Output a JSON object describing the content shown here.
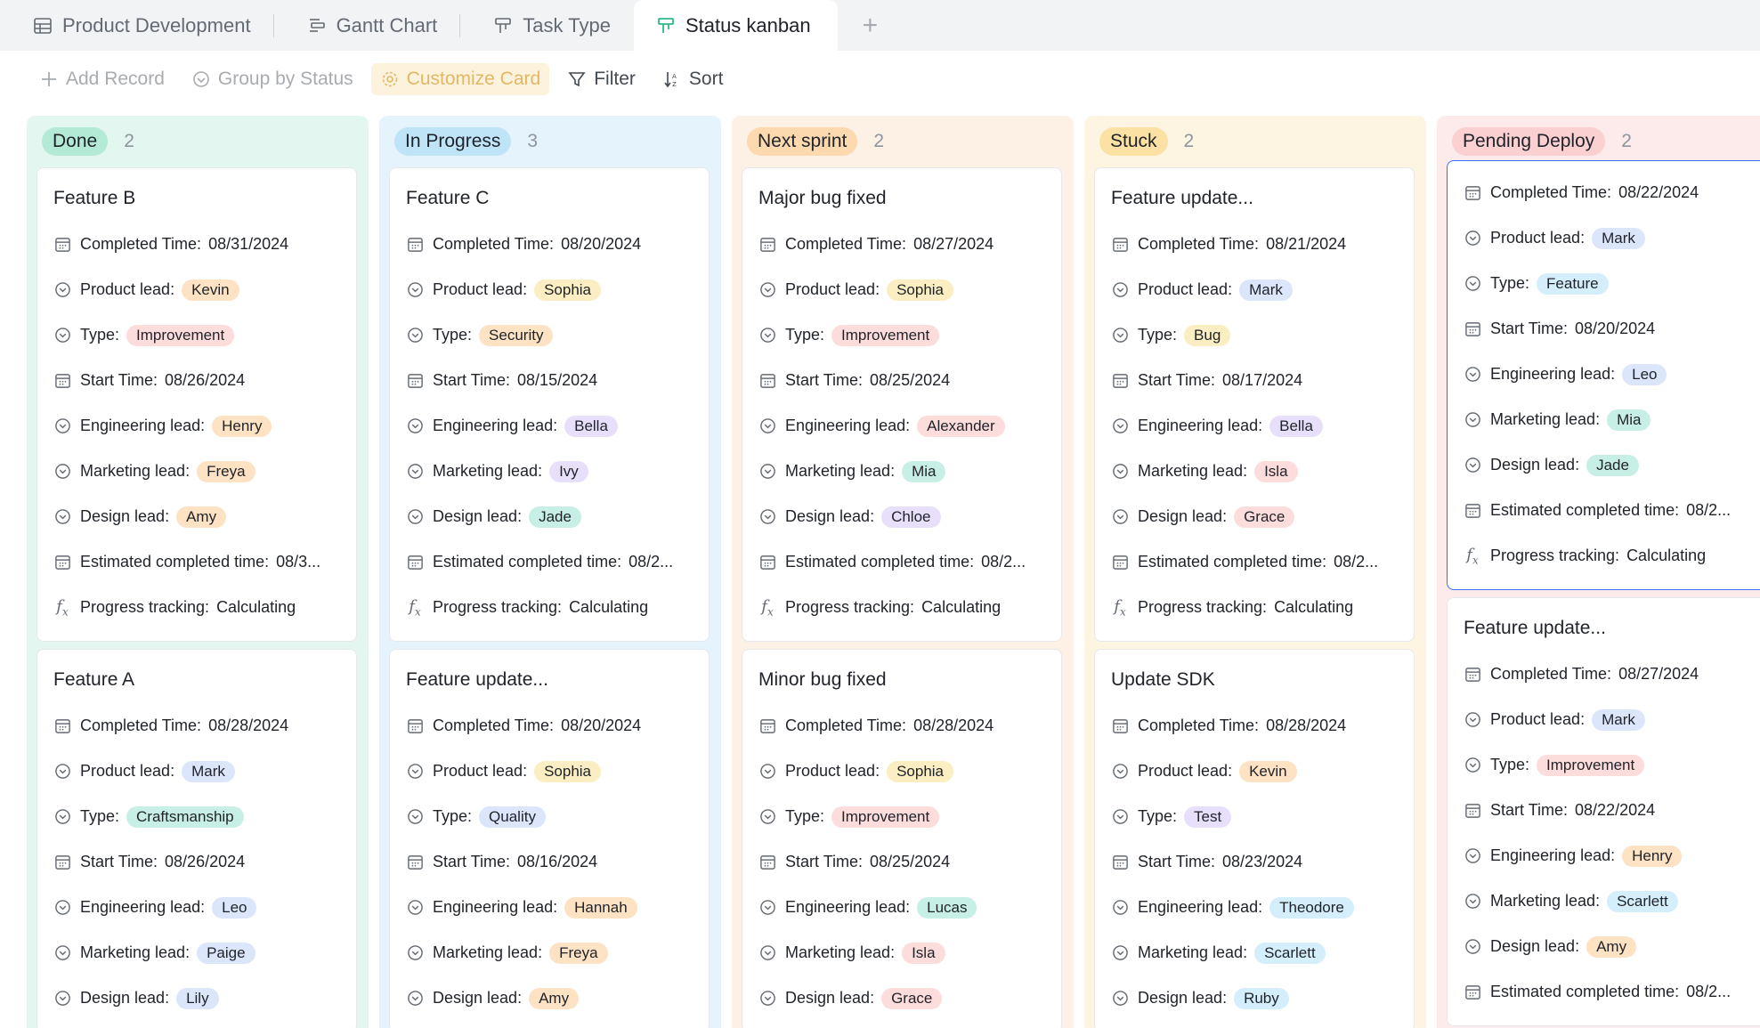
{
  "tabs": [
    {
      "label": "Product Development",
      "icon": "table-icon"
    },
    {
      "label": "Gantt Chart",
      "icon": "gantt-icon"
    },
    {
      "label": "Task Type",
      "icon": "kanban-icon"
    },
    {
      "label": "Status kanban",
      "icon": "kanban-icon",
      "active": true
    }
  ],
  "tab_add": "+",
  "toolbar": {
    "add_record": "Add Record",
    "group_by": "Group by Status",
    "customize": "Customize Card",
    "filter": "Filter",
    "sort": "Sort"
  },
  "colors": {
    "accent_blue": "#3370ff",
    "tag_orange": "#fde2c4",
    "tag_red": "#fddcdc",
    "tag_blue": "#dbe6fb",
    "tag_teal": "#c8efe5",
    "tag_purple": "#e8e0fb",
    "tag_yellow": "#fbeec2",
    "tag_cyan": "#d4eefb"
  },
  "field_labels": {
    "completed": "Completed Time:",
    "product": "Product lead:",
    "type": "Type:",
    "start": "Start Time:",
    "engineering": "Engineering lead:",
    "marketing": "Marketing lead:",
    "design": "Design lead:",
    "estimated": "Estimated completed time:",
    "progress": "Progress tracking:"
  },
  "columns": [
    {
      "name": "Done",
      "count": "2",
      "cards": [
        {
          "title": "Feature B",
          "completed": "08/31/2024",
          "product": "Kevin",
          "type": "Improvement",
          "start": "08/26/2024",
          "engineering": "Henry",
          "marketing": "Freya",
          "design": "Amy",
          "estimated": "08/3...",
          "progress": "Calculating"
        },
        {
          "title": "Feature A",
          "completed": "08/28/2024",
          "product": "Mark",
          "type": "Craftsmanship",
          "start": "08/26/2024",
          "engineering": "Leo",
          "marketing": "Paige",
          "design": "Lily"
        }
      ]
    },
    {
      "name": "In Progress",
      "count": "3",
      "cards": [
        {
          "title": "Feature C",
          "completed": "08/20/2024",
          "product": "Sophia",
          "type": "Security",
          "start": "08/15/2024",
          "engineering": "Bella",
          "marketing": "Ivy",
          "design": "Jade",
          "estimated": "08/2...",
          "progress": "Calculating"
        },
        {
          "title": "Feature update...",
          "completed": "08/20/2024",
          "product": "Sophia",
          "type": "Quality",
          "start": "08/16/2024",
          "engineering": "Hannah",
          "marketing": "Freya",
          "design": "Amy"
        }
      ]
    },
    {
      "name": "Next sprint",
      "count": "2",
      "cards": [
        {
          "title": "Major bug fixed",
          "completed": "08/27/2024",
          "product": "Sophia",
          "type": "Improvement",
          "start": "08/25/2024",
          "engineering": "Alexander",
          "marketing": "Mia",
          "design": "Chloe",
          "estimated": "08/2...",
          "progress": "Calculating"
        },
        {
          "title": "Minor bug fixed",
          "completed": "08/28/2024",
          "product": "Sophia",
          "type": "Improvement",
          "start": "08/25/2024",
          "engineering": "Lucas",
          "marketing": "Isla",
          "design": "Grace"
        }
      ]
    },
    {
      "name": "Stuck",
      "count": "2",
      "cards": [
        {
          "title": "Feature update...",
          "completed": "08/21/2024",
          "product": "Mark",
          "type": "Bug",
          "start": "08/17/2024",
          "engineering": "Bella",
          "marketing": "Isla",
          "design": "Grace",
          "estimated": "08/2...",
          "progress": "Calculating"
        },
        {
          "title": "Update SDK",
          "completed": "08/28/2024",
          "product": "Kevin",
          "type": "Test",
          "start": "08/23/2024",
          "engineering": "Theodore",
          "marketing": "Scarlett",
          "design": "Ruby"
        }
      ]
    },
    {
      "name": "Pending Deploy",
      "count": "2",
      "cards": [
        {
          "completed": "08/22/2024",
          "product": "Mark",
          "type": "Feature",
          "start": "08/20/2024",
          "engineering": "Leo",
          "marketing": "Mia",
          "design": "Jade",
          "estimated": "08/2...",
          "progress": "Calculating"
        },
        {
          "title": "Feature update...",
          "completed": "08/27/2024",
          "product": "Mark",
          "type": "Improvement",
          "start": "08/22/2024",
          "engineering": "Henry",
          "marketing": "Scarlett",
          "design": "Amy",
          "estimated": "08/2..."
        }
      ]
    }
  ]
}
